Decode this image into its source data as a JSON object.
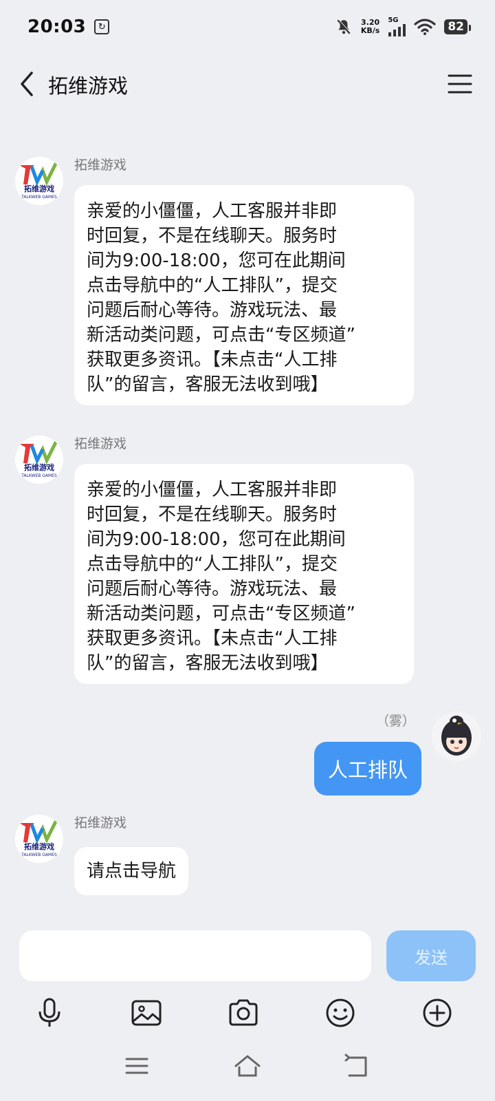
{
  "status": {
    "time": "20:03",
    "net_speed_value": "3.20",
    "net_speed_unit": "KB/s",
    "network": "5G",
    "battery": "82"
  },
  "header": {
    "title": "拓维游戏"
  },
  "messages": [
    {
      "sender": "拓维游戏",
      "text": "亲爱的小僵僵，人工客服并非即\n时回复，不是在线聊天。服务时\n间为9:00-18:00，您可在此期间\n点击导航中的“人工排队”，提交\n问题后耐心等待。游戏玩法、最\n新活动类问题，可点击“专区频道”\n获取更多资讯。【未点击“人工排\n队”的留言，客服无法收到哦】"
    },
    {
      "sender": "拓维游戏",
      "text": "亲爱的小僵僵，人工客服并非即\n时回复，不是在线聊天。服务时\n间为9:00-18:00，您可在此期间\n点击导航中的“人工排队”，提交\n问题后耐心等待。游戏玩法、最\n新活动类问题，可点击“专区频道”\n获取更多资讯。【未点击“人工排\n队”的留言，客服无法收到哦】"
    },
    {
      "sender": "（雾）",
      "text": "人工排队"
    },
    {
      "sender": "拓维游戏",
      "text": "请点击导航"
    }
  ],
  "logo": {
    "letters": "TW",
    "name": "拓维游戏",
    "sub": "TALKWEB GAMES"
  },
  "input": {
    "value": "",
    "send_label": "发送"
  },
  "colors": {
    "background": "#eeeff3",
    "user_bubble": "#4396f4",
    "send_button": "#8cc2f8"
  },
  "icons": {
    "tools": [
      "microphone-icon",
      "image-icon",
      "camera-icon",
      "emoji-icon",
      "plus-circle-icon"
    ],
    "nav": [
      "recent-apps-icon",
      "home-icon",
      "back-nav-icon"
    ]
  }
}
